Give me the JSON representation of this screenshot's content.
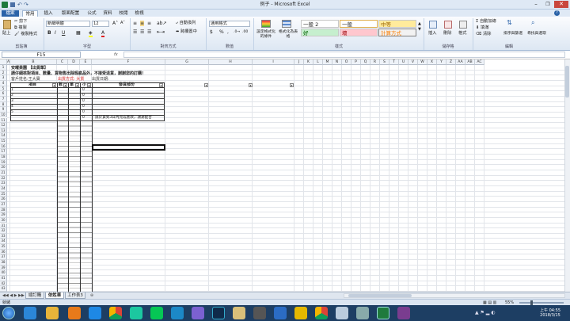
{
  "window": {
    "title": "例子 - Microsoft Excel"
  },
  "tabs": [
    "檔案",
    "常用",
    "插入",
    "版面配置",
    "公式",
    "資料",
    "校閱",
    "檢視"
  ],
  "ribbon": {
    "paste": "貼上",
    "cut": "剪下",
    "copy": "複製",
    "format_painter": "複製格式",
    "font_name": "新細明體",
    "font_size": "12",
    "wrap_text": "自動換列",
    "merge_center": "跨欄置中",
    "number_format": "通用格式",
    "cond_format": "設定格式化的條件",
    "format_table": "格式化為表格",
    "styles": [
      {
        "label": "一般 2",
        "bg": "#ffffff",
        "fg": "#222222"
      },
      {
        "label": "一般",
        "bg": "#ffffff",
        "fg": "#222222"
      },
      {
        "label": "中等",
        "bg": "#ffeb9c",
        "fg": "#9c6500"
      },
      {
        "label": "好",
        "bg": "#c6efce",
        "fg": "#006100"
      },
      {
        "label": "壞",
        "bg": "#ffc7ce",
        "fg": "#9c0006"
      },
      {
        "label": "計算方式",
        "bg": "#f2f2f2",
        "fg": "#fa7d00"
      }
    ],
    "insert": "插入",
    "delete": "刪除",
    "format": "格式",
    "autosum": "自動加總",
    "fill": "填滿",
    "clear": "清除",
    "sort_filter": "排序與篩選",
    "find_select": "尋找與選取",
    "groups": [
      "剪貼簿",
      "字型",
      "對齊方式",
      "數值",
      "樣式",
      "儲存格",
      "編輯"
    ]
  },
  "formula_bar": {
    "name_box": "F15",
    "fx": "fx",
    "content": ""
  },
  "columns": [
    "A",
    "B",
    "C",
    "D",
    "E",
    "F",
    "G",
    "H",
    "I",
    "J",
    "K",
    "L",
    "M",
    "N",
    "O",
    "P",
    "Q",
    "R",
    "S",
    "T",
    "U",
    "V",
    "W",
    "X",
    "Y",
    "Z",
    "AA",
    "AB",
    "AC"
  ],
  "rows": [
    "1",
    "2",
    "3",
    "4",
    "5",
    "6",
    "7",
    "8",
    "9",
    "10",
    "11",
    "12",
    "13",
    "14",
    "15",
    "16",
    "17",
    "18",
    "19",
    "20",
    "21",
    "22",
    "23",
    "24",
    "25",
    "26",
    "27",
    "28",
    "29",
    "30",
    "31",
    "32",
    "33",
    "34",
    "35",
    "36",
    "37",
    "38",
    "39",
    "40",
    "41",
    "42",
    "43"
  ],
  "sheet_content": {
    "title": "安曜果園 【出貨單】",
    "subtitle": "請仔細核對項目、數量、貨物售出除瑕疵品外，不接受退貨，謝謝您的訂購！",
    "customer_label": "客戶姓名:王大寶",
    "shipping_method": "出貨方式: 大貨",
    "ship_date": "出貨日期:",
    "header_item": "項目",
    "header_qty": "數",
    "header_price": "單",
    "header_subtotal": "小",
    "header_payment": "發貨部份",
    "row_numbers": [
      "1",
      "2",
      "3",
      "4",
      "5"
    ],
    "zeros": [
      "0",
      "0",
      "0",
      "0",
      "0",
      "0"
    ],
    "note": "請於貨到3日內完成匯款，謝謝配合"
  },
  "sheets": [
    {
      "name": "總訂購",
      "active": false
    },
    {
      "name": "依姓單",
      "active": true
    },
    {
      "name": "工作表3",
      "active": false
    }
  ],
  "status": {
    "ready": "就緒",
    "zoom": "55%"
  },
  "clock": {
    "time": "上午 04:55",
    "date": "2018/3/15"
  }
}
